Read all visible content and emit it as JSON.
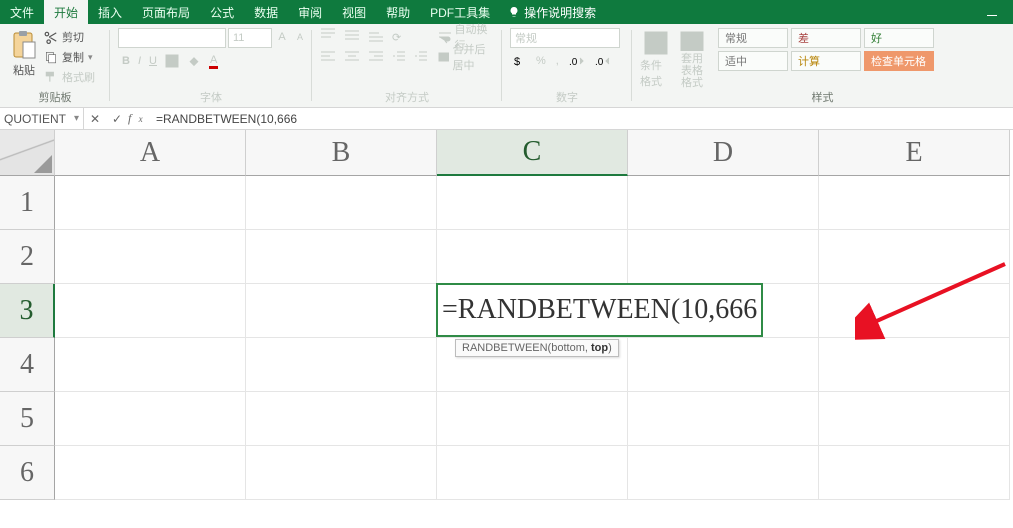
{
  "tabs": {
    "items": [
      "文件",
      "开始",
      "插入",
      "页面布局",
      "公式",
      "数据",
      "审阅",
      "视图",
      "帮助",
      "PDF工具集"
    ],
    "active_index": 1,
    "tell_me": "操作说明搜索"
  },
  "ribbon": {
    "clipboard": {
      "label": "剪贴板",
      "paste": "粘贴",
      "cut": "剪切",
      "copy": "复制",
      "format_painter": "格式刷"
    },
    "font": {
      "label": "字体",
      "font_name": "",
      "font_size": "11",
      "buttons": [
        "B",
        "I",
        "U"
      ]
    },
    "alignment": {
      "label": "对齐方式",
      "wrap": "自动换行",
      "merge": "合并后居中"
    },
    "number": {
      "label": "数字",
      "format": "常规"
    },
    "styles": {
      "label": "样式",
      "cond_format": "条件格式",
      "table_format": "套用\n表格格式",
      "normal": "常规",
      "bad": "差",
      "good": "好",
      "neutral": "适中",
      "calc": "计算",
      "check": "检查单元格"
    }
  },
  "formula_bar": {
    "name_box": "QUOTIENT",
    "formula": "=RANDBETWEEN(10,666"
  },
  "grid": {
    "columns": [
      "A",
      "B",
      "C",
      "D",
      "E"
    ],
    "rows": [
      "1",
      "2",
      "3",
      "4",
      "5",
      "6"
    ],
    "active_col": 2,
    "active_row": 2,
    "edit_text": "=RANDBETWEEN(10,666",
    "tooltip_fn": "RANDBETWEEN(",
    "tooltip_arg1": "bottom, ",
    "tooltip_arg_bold": "top",
    "tooltip_tail": ")"
  }
}
